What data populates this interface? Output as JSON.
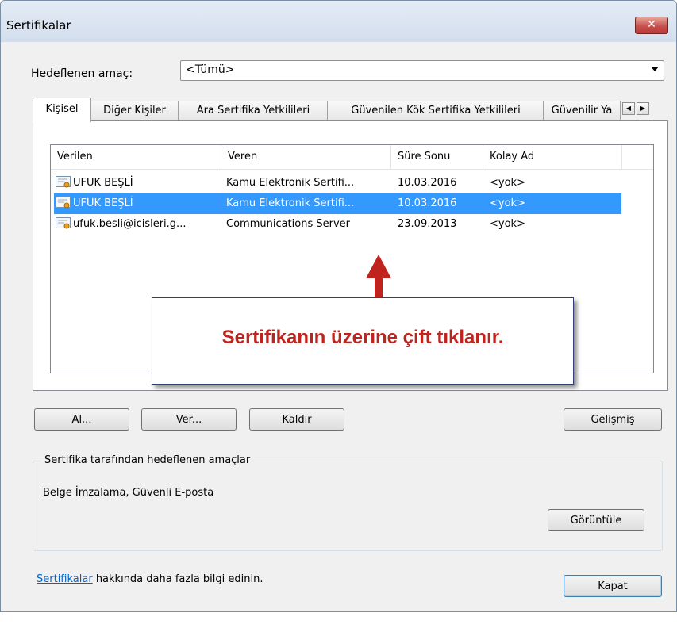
{
  "window": {
    "title": "Sertifikalar"
  },
  "purpose": {
    "label": "Hedeflenen amaç:",
    "value": "<Tümü>"
  },
  "tabs": [
    {
      "label": "Kişisel",
      "active": true
    },
    {
      "label": "Diğer Kişiler",
      "active": false
    },
    {
      "label": "Ara Sertifika Yetkilileri",
      "active": false
    },
    {
      "label": "Güvenilen Kök Sertifika Yetkilileri",
      "active": false
    },
    {
      "label": "Güvenilir Ya",
      "active": false
    }
  ],
  "list": {
    "columns": [
      "Verilen",
      "Veren",
      "Süre Sonu",
      "Kolay Ad"
    ],
    "rows": [
      {
        "issued_to": "UFUK BEŞLİ",
        "issued_by": "Kamu Elektronik Sertifi...",
        "expires": "10.03.2016",
        "friendly": "<yok>",
        "selected": false
      },
      {
        "issued_to": "UFUK BEŞLİ",
        "issued_by": "Kamu Elektronik Sertifi...",
        "expires": "10.03.2016",
        "friendly": "<yok>",
        "selected": true
      },
      {
        "issued_to": "ufuk.besli@icisleri.g...",
        "issued_by": "Communications Server",
        "expires": "23.09.2013",
        "friendly": "<yok>",
        "selected": false
      }
    ]
  },
  "callout": {
    "text": "Sertifikanın üzerine çift tıklanır.",
    "text_color": "#c0221e",
    "arrow_color": "#c0221e"
  },
  "buttons": {
    "import": "Al...",
    "export": "Ver...",
    "remove": "Kaldır",
    "advanced": "Gelişmiş",
    "view": "Görüntüle",
    "close": "Kapat"
  },
  "purposes": {
    "label": "Sertifika tarafından hedeflenen amaçlar",
    "text": "Belge İmzalama, Güvenli E-posta"
  },
  "footer": {
    "link": "Sertifikalar",
    "text": " hakkında daha fazla bilgi edinin."
  },
  "colors": {
    "selection": "#3399ff",
    "link": "#0066cc"
  }
}
